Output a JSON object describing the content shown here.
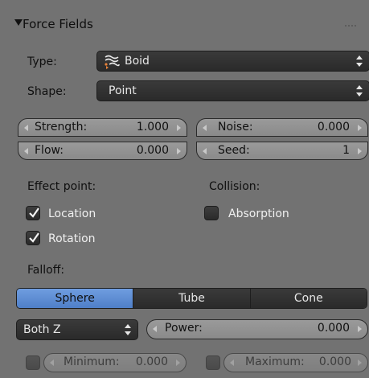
{
  "header": {
    "title": "Force Fields"
  },
  "type_row": {
    "label": "Type:",
    "value": "Boid",
    "icon": "boid-icon"
  },
  "shape_row": {
    "label": "Shape:",
    "value": "Point"
  },
  "fields": {
    "strength": {
      "label": "Strength:",
      "value": "1.000"
    },
    "noise": {
      "label": "Noise:",
      "value": "0.000"
    },
    "flow": {
      "label": "Flow:",
      "value": "0.000"
    },
    "seed": {
      "label": "Seed:",
      "value": "1"
    }
  },
  "effect_point": {
    "label": "Effect point:",
    "location": {
      "label": "Location",
      "checked": true
    },
    "rotation": {
      "label": "Rotation",
      "checked": true
    }
  },
  "collision": {
    "label": "Collision:",
    "absorption": {
      "label": "Absorption",
      "checked": false
    }
  },
  "falloff": {
    "label": "Falloff:",
    "tabs": [
      "Sphere",
      "Tube",
      "Cone"
    ],
    "active_tab": "Sphere",
    "axis_dropdown": "Both Z",
    "power": {
      "label": "Power:",
      "value": "0.000"
    },
    "minimum": {
      "label": "Minimum:",
      "value": "0.000"
    },
    "maximum": {
      "label": "Maximum:",
      "value": "0.000"
    }
  },
  "colors": {
    "active_tab": "#5a8ad4",
    "panel": "#727272",
    "dark_widget": "#2f2f2f"
  }
}
